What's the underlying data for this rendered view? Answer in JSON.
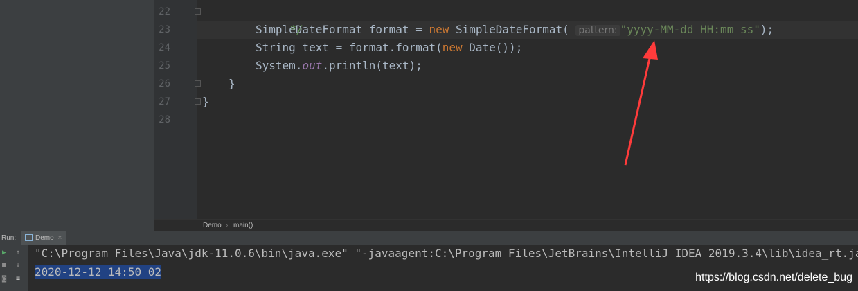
{
  "gutter": {
    "line_numbers": [
      "22",
      "23",
      "24",
      "25",
      "26",
      "27",
      "28"
    ]
  },
  "code": {
    "line22": "*/",
    "line23_a": "SimpleDateFormat format = ",
    "line23_kw": "new",
    "line23_b": " SimpleDateFormat(",
    "line23_hint": "pattern:",
    "line23_str": "\"yyyy-MM-dd HH:mm ss\"",
    "line23_c": ");",
    "line24_a": "String text = format.format(",
    "line24_kw": "new",
    "line24_b": " Date());",
    "line25_a": "System.",
    "line25_field": "out",
    "line25_b": ".println(text);",
    "line26": "}",
    "line27": "}"
  },
  "breadcrumb": {
    "items": [
      "Demo",
      "main()"
    ]
  },
  "run_panel": {
    "label": "Run:",
    "tab_label": "Demo",
    "console_lines": [
      "\"C:\\Program Files\\Java\\jdk-11.0.6\\bin\\java.exe\" \"-javaagent:C:\\Program Files\\JetBrains\\IntelliJ IDEA 2019.3.4\\lib\\idea_rt.ja",
      "2020-12-12 14:50 02"
    ]
  },
  "watermark": "https://blog.csdn.net/delete_bug",
  "colors": {
    "annotation_arrow": "#ff3b3b",
    "keyword": "#cc7832",
    "string": "#6a8759"
  }
}
